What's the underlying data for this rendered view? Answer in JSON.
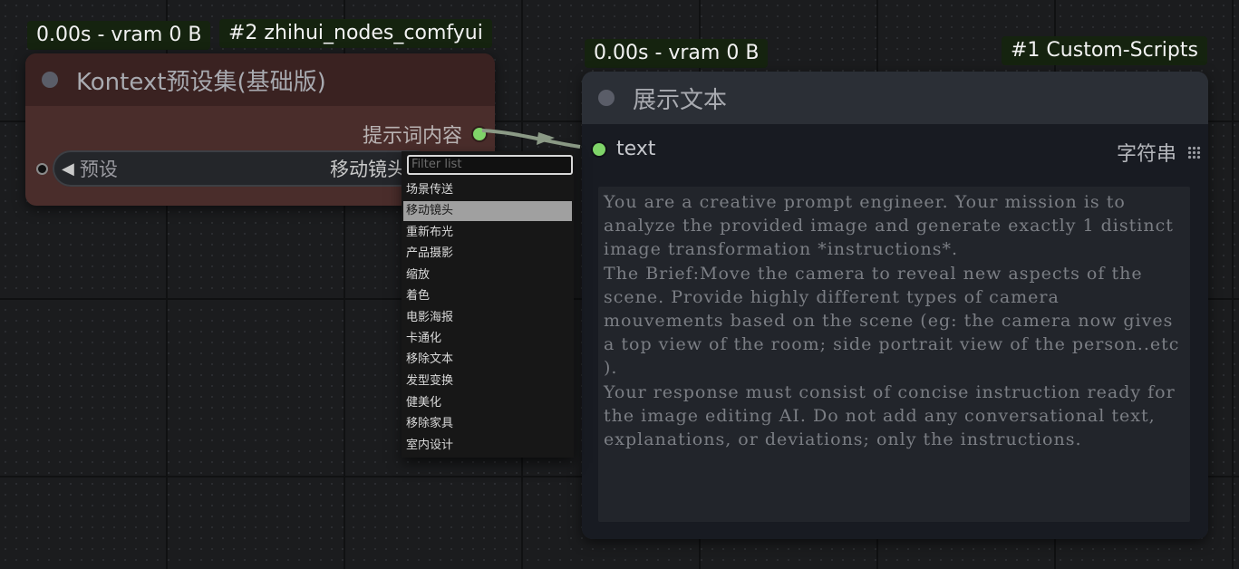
{
  "node2": {
    "time_badge": "0.00s - vram 0 B",
    "id_badge": "#2 zhihui_nodes_comfyui",
    "title": "Kontext预设集(基础版)",
    "output_label": "提示词内容",
    "widget": {
      "arrow": "◀",
      "label": "预设",
      "value": "移动镜头"
    }
  },
  "dropdown": {
    "filter_placeholder": "Filter list",
    "items": [
      "场景传送",
      "移动镜头",
      "重新布光",
      "产品摄影",
      "缩放",
      "着色",
      "电影海报",
      "卡通化",
      "移除文本",
      "发型变换",
      "健美化",
      "移除家具",
      "室内设计"
    ],
    "selected": "移动镜头"
  },
  "node1": {
    "time_badge": "0.00s - vram 0 B",
    "id_badge": "#1 Custom-Scripts",
    "title": "展示文本",
    "input_label": "text",
    "type_label": "字符串",
    "text": "You are a creative prompt engineer. Your mission is to analyze the provided image and generate exactly 1 distinct image transformation *instructions*.\nThe Brief:Move the camera to reveal new aspects of the scene. Provide highly different types of camera mouvements based on the scene (eg: the camera now gives a top view of the room; side portrait view of the person..etc ).\nYour response must consist of concise instruction ready for the image editing AI. Do not add any conversational text, explanations, or deviations; only the instructions."
  },
  "colors": {
    "slot_green": "#7fd469",
    "badge_bg": "#15230f",
    "node2_body": "#4a2d2b",
    "node1_body": "#181b22"
  },
  "icons": {
    "title_dot": "status-dot-icon",
    "widget_arrow": "left-triangle-icon",
    "type_grid": "grid-icon"
  }
}
